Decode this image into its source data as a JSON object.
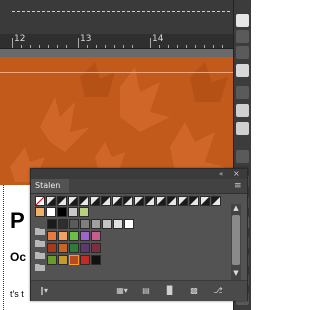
{
  "ruler": {
    "mark_12": "12",
    "mark_13": "13",
    "mark_14": "14"
  },
  "document": {
    "line1": "P",
    "line2": "Oc",
    "line3": "t's t"
  },
  "swatches_panel": {
    "tab_label": "Stalen",
    "collapse_icon": "double-chevron-icon",
    "close_icon": "close-icon",
    "menu_icon": "panel-menu-icon",
    "row1": [
      "none",
      "slash",
      "slash",
      "slash",
      "slash",
      "slash",
      "slash",
      "slash",
      "slash",
      "slash",
      "slash",
      "slash",
      "slash",
      "slash",
      "slash",
      "slash",
      "slash"
    ],
    "row2": [
      "#f0b06a",
      "#ffffff",
      "#000000",
      "#c8c8c8",
      "#b8d080"
    ],
    "row3": [
      "#1a1a1a",
      "#2e2e2e",
      "#5b5b5b",
      "#7f7f7f",
      "#9f9f9f",
      "#c4c4c4",
      "#e0e0e0",
      "#ffffff"
    ],
    "row4": [
      "#e87a3c",
      "#f2a064",
      "#6abe4a",
      "#9a66c8",
      "#c85d8c"
    ],
    "row5": [
      "#a83a1c",
      "#c86428",
      "#2e7a3a",
      "#5a3a70",
      "#7a3040"
    ],
    "row6": [
      "#6a9a2c",
      "#c69a2a",
      "#b84a1e",
      "#c22a2a",
      "#111111"
    ],
    "icons": [
      "library-icon",
      "swatch-kind-icon",
      "swatch-options-icon",
      "new-group-icon",
      "new-swatch-icon",
      "delete-icon"
    ]
  },
  "colors": {
    "canvas_orange": "#c25a1c",
    "panel_bg": "#535353",
    "ui_dark": "#3a3a3a"
  }
}
